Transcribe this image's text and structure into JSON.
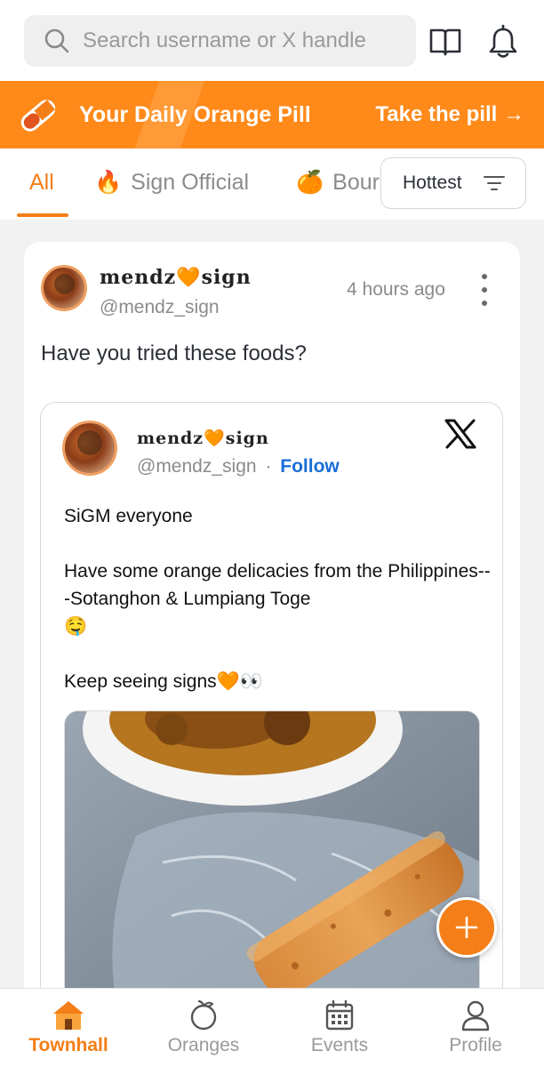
{
  "search": {
    "placeholder": "Search username or X handle",
    "icon": "search-icon"
  },
  "top_icons": [
    "book-icon",
    "bell-icon"
  ],
  "banner": {
    "title": "Your Daily Orange Pill",
    "cta": "Take the pill →",
    "icon": "pill-icon"
  },
  "tabs": [
    {
      "label": "All",
      "emoji": ""
    },
    {
      "label": "Sign Official",
      "emoji": "🔥"
    },
    {
      "label": "Bour",
      "emoji": "🍊"
    }
  ],
  "sort": {
    "label": "Hottest"
  },
  "post": {
    "author_name": "mendz",
    "author_suffix": "sign",
    "heart": "🧡",
    "handle": "@mendz_sign",
    "time": "4 hours ago",
    "text": "Have you tried these foods?"
  },
  "embed": {
    "author_name": "mendz",
    "author_suffix": "sign",
    "heart": "🧡",
    "handle": "@mendz_sign",
    "separator": "·",
    "follow": "Follow",
    "line1": "SiGM everyone",
    "line2": "Have some orange delicacies from the Philippines---Sotanghon & Lumpiang Toge",
    "line2_emoji": "🤤",
    "line3": "Keep seeing signs",
    "line3_emoji": "🧡👀"
  },
  "nav": [
    {
      "label": "Townhall",
      "icon": "townhall-icon",
      "active": true
    },
    {
      "label": "Oranges",
      "icon": "orange-icon",
      "active": false
    },
    {
      "label": "Events",
      "icon": "calendar-icon",
      "active": false
    },
    {
      "label": "Profile",
      "icon": "profile-icon",
      "active": false
    }
  ],
  "colors": {
    "accent": "#f47e17",
    "banner": "#ff8a1a",
    "link": "#1a6fd6"
  }
}
